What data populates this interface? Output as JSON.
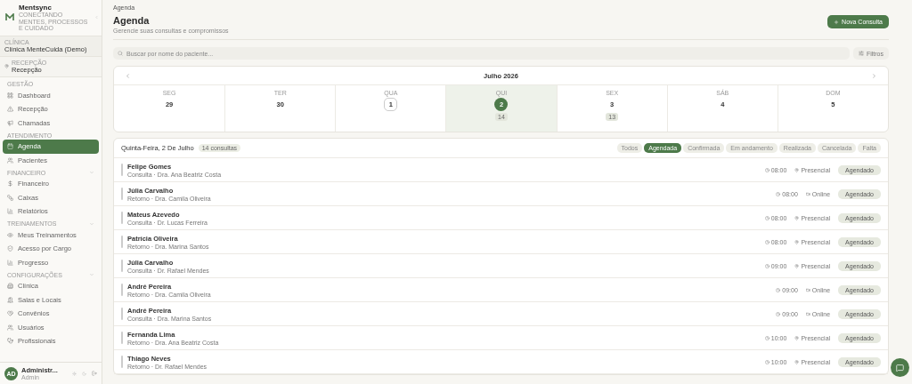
{
  "sidebar": {
    "brand": {
      "name": "Mentsync",
      "tagline": "CONECTANDO MENTES, PROCESSOS E CUIDADO"
    },
    "clinic": {
      "label": "CLÍNICA",
      "value": "Clínica MenteCuida (Demo)"
    },
    "reception": {
      "label": "RECEPÇÃO",
      "value": "Recepção"
    },
    "sections": [
      {
        "title": "GESTÃO",
        "items": [
          {
            "label": "Dashboard",
            "selected": false
          },
          {
            "label": "Recepção",
            "selected": false
          },
          {
            "label": "Chamadas",
            "selected": false
          }
        ]
      },
      {
        "title": "ATENDIMENTO",
        "items": [
          {
            "label": "Agenda",
            "selected": true
          },
          {
            "label": "Pacientes",
            "selected": false
          }
        ]
      },
      {
        "title": "FINANCEIRO",
        "expanded": true,
        "items": [
          {
            "label": "Financeiro",
            "selected": false
          },
          {
            "label": "Caixas",
            "selected": false
          },
          {
            "label": "Relatórios",
            "selected": false
          }
        ]
      },
      {
        "title": "TREINAMENTOS",
        "expanded": true,
        "items": [
          {
            "label": "Meus Treinamentos",
            "selected": false
          },
          {
            "label": "Acesso por Cargo",
            "selected": false
          },
          {
            "label": "Progresso",
            "selected": false
          }
        ]
      },
      {
        "title": "CONFIGURAÇÕES",
        "expanded": true,
        "items": [
          {
            "label": "Clínica",
            "selected": false
          },
          {
            "label": "Salas e Locais",
            "selected": false
          },
          {
            "label": "Convênios",
            "selected": false
          },
          {
            "label": "Usuários",
            "selected": false
          },
          {
            "label": "Profissionais",
            "selected": false
          }
        ]
      }
    ],
    "user": {
      "initials": "AD",
      "name": "Administr...",
      "role": "Admin"
    }
  },
  "breadcrumb": "Agenda",
  "header": {
    "title": "Agenda",
    "subtitle": "Gerencie suas consultas e compromissos",
    "button": "Nova Consulta"
  },
  "search": {
    "placeholder": "Buscar por nome do paciente...",
    "filters_button": "Filtros"
  },
  "calendar": {
    "month": "Julho 2026",
    "days": [
      {
        "weekday": "SEG",
        "date": "29",
        "selected": false,
        "today": false
      },
      {
        "weekday": "TER",
        "date": "30",
        "selected": false,
        "today": false
      },
      {
        "weekday": "QUA",
        "date": "1",
        "selected": false,
        "today": true
      },
      {
        "weekday": "QUI",
        "date": "2",
        "selected": true,
        "today": false,
        "count": "14"
      },
      {
        "weekday": "SEX",
        "date": "3",
        "selected": false,
        "today": false,
        "count": "13"
      },
      {
        "weekday": "SÁB",
        "date": "4",
        "selected": false,
        "today": false
      },
      {
        "weekday": "DOM",
        "date": "5",
        "selected": false,
        "today": false
      }
    ]
  },
  "list": {
    "date": "Quinta-Feira, 2 De Julho",
    "count": "14 consultas",
    "filters": [
      {
        "label": "Todos",
        "selected": false
      },
      {
        "label": "Agendada",
        "selected": true
      },
      {
        "label": "Confirmada",
        "selected": false
      },
      {
        "label": "Em andamento",
        "selected": false
      },
      {
        "label": "Realizada",
        "selected": false
      },
      {
        "label": "Cancelada",
        "selected": false
      },
      {
        "label": "Falta",
        "selected": false
      }
    ],
    "rows": [
      {
        "name": "Felipe Gomes",
        "detail": "Consulta · Dra. Ana Beatriz Costa",
        "time": "08:00",
        "kind": "presencial",
        "mode": "Presencial",
        "status": "Agendado"
      },
      {
        "name": "Júlia Carvalho",
        "detail": "Retorno · Dra. Camila Oliveira",
        "time": "08:00",
        "kind": "online",
        "mode": "Online",
        "status": "Agendado"
      },
      {
        "name": "Mateus Azevedo",
        "detail": "Consulta · Dr. Lucas Ferreira",
        "time": "08:00",
        "kind": "presencial",
        "mode": "Presencial",
        "status": "Agendado"
      },
      {
        "name": "Patrícia Oliveira",
        "detail": "Retorno · Dra. Marina Santos",
        "time": "08:00",
        "kind": "presencial",
        "mode": "Presencial",
        "status": "Agendado"
      },
      {
        "name": "Júlia Carvalho",
        "detail": "Consulta · Dr. Rafael Mendes",
        "time": "09:00",
        "kind": "presencial",
        "mode": "Presencial",
        "status": "Agendado"
      },
      {
        "name": "André Pereira",
        "detail": "Retorno · Dra. Camila Oliveira",
        "time": "09:00",
        "kind": "online",
        "mode": "Online",
        "status": "Agendado"
      },
      {
        "name": "André Pereira",
        "detail": "Consulta · Dra. Marina Santos",
        "time": "09:00",
        "kind": "online",
        "mode": "Online",
        "status": "Agendado"
      },
      {
        "name": "Fernanda Lima",
        "detail": "Retorno · Dra. Ana Beatriz Costa",
        "time": "10:00",
        "kind": "presencial",
        "mode": "Presencial",
        "status": "Agendado"
      },
      {
        "name": "Thiago Neves",
        "detail": "Retorno · Dr. Rafael Mendes",
        "time": "10:00",
        "kind": "presencial",
        "mode": "Presencial",
        "status": "Agendado"
      }
    ]
  }
}
